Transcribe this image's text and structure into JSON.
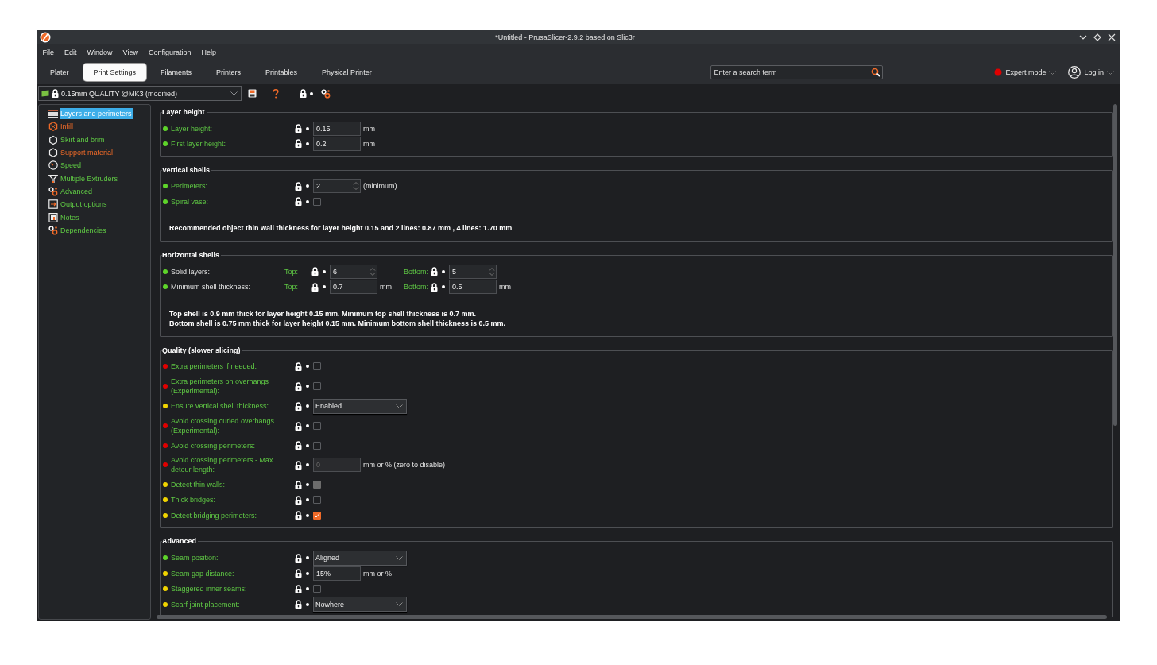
{
  "window": {
    "title": "*Untitled - PrusaSlicer-2.9.2 based on Slic3r"
  },
  "menu": [
    "File",
    "Edit",
    "Window",
    "View",
    "Configuration",
    "Help"
  ],
  "tabs": [
    {
      "label": "Plater",
      "selected": false
    },
    {
      "label": "Print Settings",
      "selected": true
    },
    {
      "label": "Filaments",
      "selected": false
    },
    {
      "label": "Printers",
      "selected": false
    },
    {
      "label": "Printables",
      "selected": false
    },
    {
      "label": "Physical Printer",
      "selected": false
    }
  ],
  "search": {
    "placeholder": "Enter a search term"
  },
  "mode": {
    "label": "Expert mode",
    "color": "#e00000"
  },
  "account": {
    "label": "Log in"
  },
  "preset": {
    "value": "0.15mm QUALITY @MK3 (modified)"
  },
  "sidebar": {
    "items": [
      {
        "label": "Layers and perimeters",
        "selected": true,
        "modified": false
      },
      {
        "label": "Infill",
        "selected": false,
        "modified": true
      },
      {
        "label": "Skirt and brim",
        "selected": false,
        "modified": false
      },
      {
        "label": "Support material",
        "selected": false,
        "modified": true
      },
      {
        "label": "Speed",
        "selected": false,
        "modified": false
      },
      {
        "label": "Multiple Extruders",
        "selected": false,
        "modified": false
      },
      {
        "label": "Advanced",
        "selected": false,
        "modified": false
      },
      {
        "label": "Output options",
        "selected": false,
        "modified": false
      },
      {
        "label": "Notes",
        "selected": false,
        "modified": false
      },
      {
        "label": "Dependencies",
        "selected": false,
        "modified": false
      }
    ]
  },
  "sections": [
    {
      "title": "Layer height",
      "rows": [
        {
          "kind": "text",
          "label": "Layer height:",
          "color": "#5ed42a",
          "system": true,
          "value": "0.15",
          "unit": "mm",
          "disabled": false
        },
        {
          "kind": "text",
          "label": "First layer height:",
          "color": "#5ed42a",
          "system": true,
          "value": "0.2",
          "unit": "mm",
          "disabled": false
        }
      ]
    },
    {
      "title": "Vertical shells",
      "rows": [
        {
          "kind": "spin",
          "label": "Perimeters:",
          "color": "#5ed42a",
          "system": true,
          "value": "2",
          "unit": "(minimum)"
        },
        {
          "kind": "checkbox",
          "label": "Spiral vase:",
          "color": "#5ed42a",
          "system": true,
          "checked": false,
          "disabled": false
        }
      ],
      "notes": [
        "Recommended object thin wall thickness for layer height 0.15 and 2 lines: 0.87 mm , 4 lines: 1.70 mm"
      ]
    },
    {
      "title": "Horizontal shells",
      "rows": [
        {
          "kind": "pair",
          "label": "Solid layers:",
          "color": "#5ed42a",
          "system": false,
          "parts": [
            {
              "label": "Top:",
              "kind": "spin",
              "value": "6"
            },
            {
              "label": "Bottom:",
              "kind": "spin",
              "value": "5"
            }
          ]
        },
        {
          "kind": "pair",
          "label": "Minimum shell thickness:",
          "color": "#5ed42a",
          "system": false,
          "parts": [
            {
              "label": "Top:",
              "kind": "text",
              "value": "0.7",
              "unit": "mm"
            },
            {
              "label": "Bottom:",
              "kind": "text",
              "value": "0.5",
              "unit": "mm"
            }
          ]
        }
      ],
      "notes": [
        "Top shell is 0.9 mm thick for layer height 0.15 mm. Minimum top shell thickness is 0.7 mm.",
        "Bottom shell is 0.75 mm thick for layer height 0.15 mm. Minimum bottom shell thickness is 0.5 mm."
      ]
    },
    {
      "title": "Quality (slower slicing)",
      "rows": [
        {
          "kind": "checkbox",
          "label": "Extra perimeters if needed:",
          "color": "#e00000",
          "system": true,
          "checked": false,
          "disabled": false
        },
        {
          "kind": "checkbox",
          "label": "Extra perimeters on overhangs\n(Experimental):",
          "color": "#e00000",
          "system": true,
          "checked": false,
          "disabled": false
        },
        {
          "kind": "select",
          "label": "Ensure vertical shell thickness:",
          "color": "#f0d400",
          "system": true,
          "value": "Enabled"
        },
        {
          "kind": "checkbox",
          "label": "Avoid crossing curled overhangs\n(Experimental):",
          "color": "#e00000",
          "system": true,
          "checked": false,
          "disabled": false
        },
        {
          "kind": "checkbox",
          "label": "Avoid crossing perimeters:",
          "color": "#e00000",
          "system": true,
          "checked": false,
          "disabled": false
        },
        {
          "kind": "text",
          "label": "Avoid crossing perimeters - Max\ndetour length:",
          "color": "#e00000",
          "system": true,
          "value": "0",
          "unit": "mm or % (zero to disable)",
          "disabled": true
        },
        {
          "kind": "checkbox",
          "label": "Detect thin walls:",
          "color": "#f0d400",
          "system": true,
          "checked": false,
          "disabled": true
        },
        {
          "kind": "checkbox",
          "label": "Thick bridges:",
          "color": "#f0d400",
          "system": true,
          "checked": false,
          "disabled": false
        },
        {
          "kind": "checkbox",
          "label": "Detect bridging perimeters:",
          "color": "#f0d400",
          "system": true,
          "checked": true,
          "disabled": false
        }
      ]
    },
    {
      "title": "Advanced",
      "rows": [
        {
          "kind": "select",
          "label": "Seam position:",
          "color": "#5ed42a",
          "system": true,
          "value": "Aligned"
        },
        {
          "kind": "text",
          "label": "Seam gap distance:",
          "color": "#f0d400",
          "system": true,
          "value": "15%",
          "unit": "mm or %",
          "disabled": false
        },
        {
          "kind": "checkbox",
          "label": "Staggered inner seams:",
          "color": "#f0d400",
          "system": true,
          "checked": false,
          "disabled": false
        },
        {
          "kind": "select",
          "label": "Scarf joint placement:",
          "color": "#f0d400",
          "system": true,
          "value": "Nowhere"
        }
      ]
    }
  ]
}
